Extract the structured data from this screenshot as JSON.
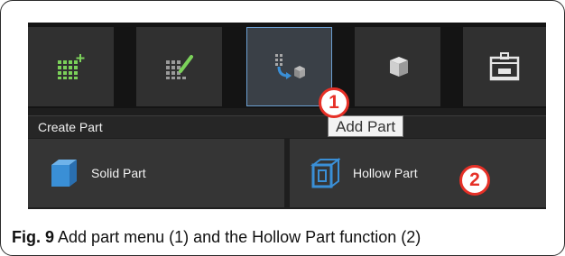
{
  "toolbar": {
    "tools": [
      {
        "icon": "add-grid-icon"
      },
      {
        "icon": "edit-grid-icon"
      },
      {
        "icon": "add-part-icon"
      },
      {
        "icon": "cube-icon"
      },
      {
        "icon": "printer-icon"
      }
    ],
    "tooltip": "Add Part"
  },
  "section": {
    "title": "Create Part"
  },
  "parts": {
    "solid_label": "Solid Part",
    "hollow_label": "Hollow Part"
  },
  "callouts": {
    "one": "1",
    "two": "2"
  },
  "caption": {
    "label": "Fig. 9",
    "text": "Add part menu (1) and the Hollow Part function (2)"
  },
  "colors": {
    "accent_blue": "#3a8fd6",
    "active_border": "#6b9ed1",
    "callout_red": "#e63027",
    "green_grid": "#7bd15a"
  }
}
